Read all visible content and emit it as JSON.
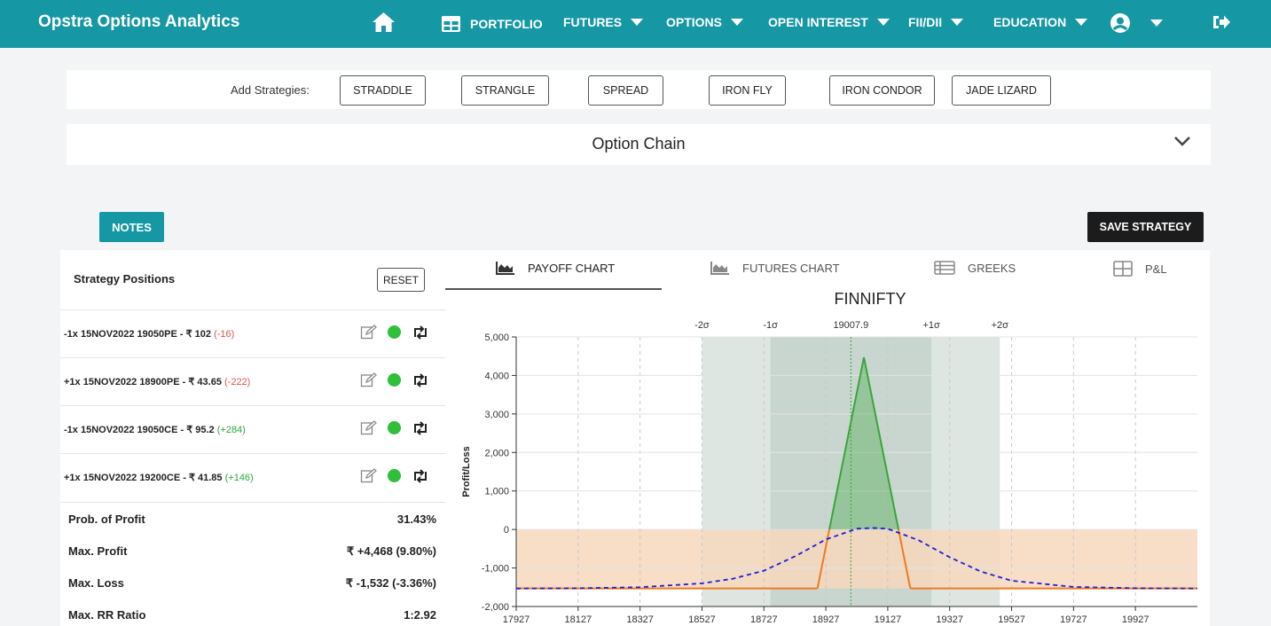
{
  "brand": "Opstra Options Analytics",
  "nav": {
    "portfolio": "PORTFOLIO",
    "futures": "FUTURES",
    "options": "OPTIONS",
    "open_interest": "OPEN INTEREST",
    "fii_dii": "FII/DII",
    "education": "EDUCATION"
  },
  "strategies": {
    "label": "Add Strategies:",
    "buttons": [
      "STRADDLE",
      "STRANGLE",
      "SPREAD",
      "IRON FLY",
      "IRON CONDOR",
      "JADE LIZARD"
    ]
  },
  "option_chain": {
    "title": "Option Chain"
  },
  "notes_label": "NOTES",
  "save_label": "SAVE STRATEGY",
  "positions_panel": {
    "title": "Strategy Positions",
    "reset_label": "RESET",
    "positions": [
      {
        "text": "-1x 15NOV2022 19050PE - ₹ 102",
        "change": "(-16)",
        "sign": "neg"
      },
      {
        "text": "+1x 15NOV2022 18900PE - ₹ 43.65",
        "change": "(-222)",
        "sign": "neg"
      },
      {
        "text": "-1x 15NOV2022 19050CE - ₹ 95.2",
        "change": "(+284)",
        "sign": "pos"
      },
      {
        "text": "+1x 15NOV2022 19200CE - ₹ 41.85",
        "change": "(+146)",
        "sign": "pos"
      }
    ],
    "stats": [
      {
        "label": "Prob. of Profit",
        "value": "31.43%"
      },
      {
        "label": "Max. Profit",
        "value": "₹ +4,468 (9.80%)"
      },
      {
        "label": "Max. Loss",
        "value": "₹ -1,532 (-3.36%)"
      },
      {
        "label": "Max. RR Ratio",
        "value": "1:2.92"
      }
    ]
  },
  "tabs": [
    "PAYOFF CHART",
    "FUTURES CHART",
    "GREEKS",
    "P&L"
  ],
  "colors": {
    "accent": "#1697a4",
    "payoff_profit": "#3aa53a",
    "payoff_loss": "#f07a1e",
    "expected_curve": "#1f1fd6",
    "sigma1_band": "#c8d6cf",
    "sigma2_band": "#dde6e1",
    "loss_fill": "#f7d7bd"
  },
  "chart_data": {
    "type": "line",
    "title": "FINNIFTY",
    "ylabel": "Profit/Loss",
    "xlabel": "",
    "xlim": [
      17927,
      20127
    ],
    "ylim": [
      -2000,
      5000
    ],
    "x_ticks": [
      17927,
      18127,
      18327,
      18527,
      18727,
      18927,
      19127,
      19327,
      19527,
      19727,
      19927
    ],
    "y_ticks": [
      5000,
      4000,
      3000,
      2000,
      1000,
      0,
      -1000,
      -2000
    ],
    "y_tick_labels": [
      "5,000",
      "4,000",
      "3,000",
      "2,000",
      "1,000",
      "0",
      "-1,000",
      "-2,000"
    ],
    "top_markers": [
      {
        "label": "-2σ",
        "x": 18527
      },
      {
        "label": "-1σ",
        "x": 18748
      },
      {
        "label": "19007.9",
        "x": 19007.9
      },
      {
        "label": "+1σ",
        "x": 19268
      },
      {
        "label": "+2σ",
        "x": 19489
      }
    ],
    "sigma_bands": {
      "minus2": 18527,
      "minus1": 18748,
      "plus1": 19268,
      "plus2": 19489
    },
    "spot": 19007.9,
    "series": [
      {
        "name": "",
        "x": [
          17927,
          18900,
          19050,
          19200,
          20127
        ],
        "y": [
          -1532,
          -1532,
          4468,
          -1532,
          -1532
        ]
      },
      {
        "name": "",
        "x": [
          17927,
          18127,
          18327,
          18527,
          18627,
          18727,
          18827,
          18927,
          19027,
          19077,
          19127,
          19227,
          19327,
          19427,
          19527,
          19727,
          19927,
          20127
        ],
        "y": [
          -1532,
          -1525,
          -1500,
          -1400,
          -1280,
          -1070,
          -700,
          -260,
          20,
          40,
          20,
          -280,
          -720,
          -1090,
          -1330,
          -1490,
          -1525,
          -1532
        ]
      }
    ]
  }
}
